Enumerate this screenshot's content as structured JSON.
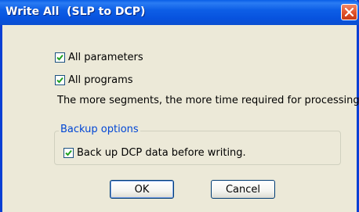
{
  "window": {
    "title": "Write All  (SLP to DCP)"
  },
  "options": {
    "all_parameters": {
      "label": "All parameters",
      "checked": true
    },
    "all_programs": {
      "label": "All programs",
      "checked": true
    }
  },
  "info_text": "The more segments, the more time required for processing.",
  "backup": {
    "legend": "Backup options",
    "backup_label": "Back up DCP data before writing.",
    "checked": true
  },
  "buttons": {
    "ok": "OK",
    "cancel": "Cancel"
  },
  "colors": {
    "titlebar": "#0a5fe8",
    "close": "#e2562e",
    "group_legend": "#0046d5",
    "check": "#21a121",
    "dialog_bg": "#ece9d8"
  }
}
